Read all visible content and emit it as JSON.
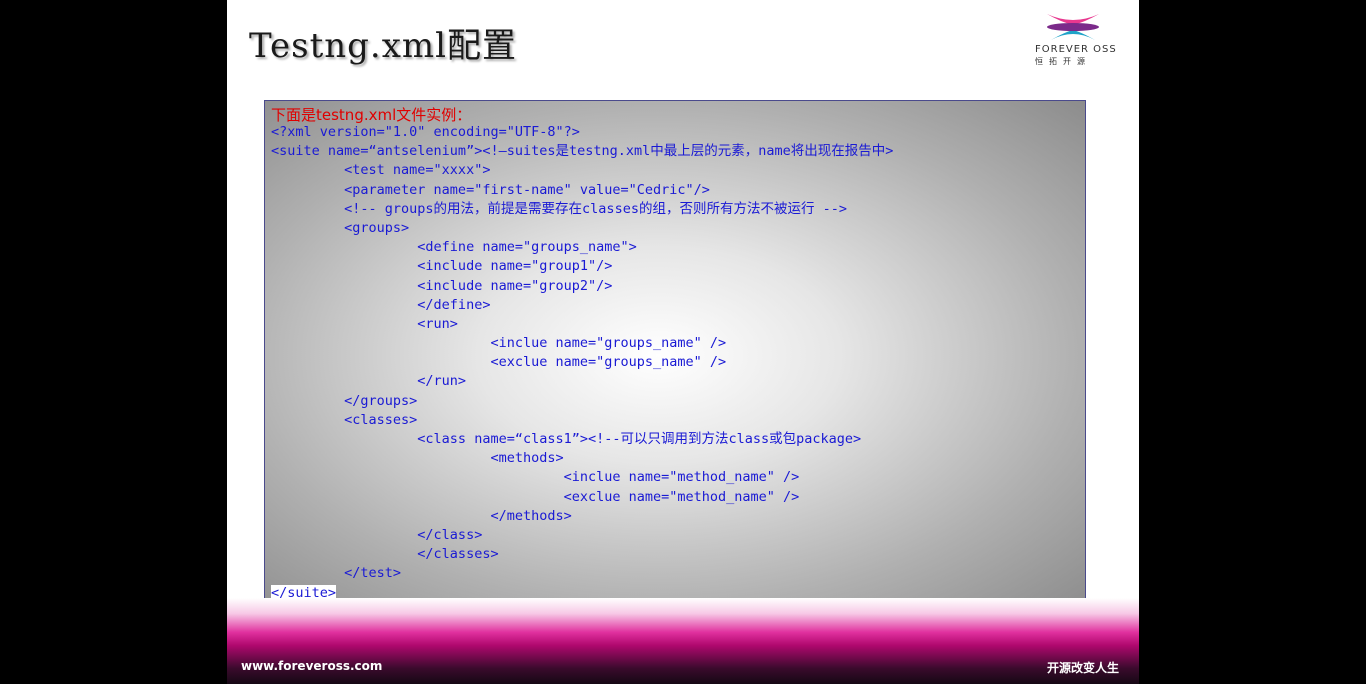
{
  "slide": {
    "title": "Testng.xml配置"
  },
  "logo": {
    "brand_en": "FOREVER OSS",
    "brand_cn": "恒拓开源"
  },
  "code_block": {
    "header": "下面是testng.xml文件实例：",
    "lines": [
      "<?xml version=\"1.0\" encoding=\"UTF-8\"?>",
      "<suite name=“antselenium”><!—suites是testng.xml中最上层的元素，name将出现在报告中>",
      "         <test name=\"xxxx\">",
      "         <parameter name=\"first-name\" value=\"Cedric\"/>",
      "         <!-- groups的用法，前提是需要存在classes的组，否则所有方法不被运行 -->",
      "         <groups>",
      "                  <define name=\"groups_name\">",
      "                  <include name=\"group1\"/>",
      "                  <include name=\"group2\"/>",
      "                  </define>",
      "                  <run>",
      "                           <inclue name=\"groups_name\" />",
      "                           <exclue name=\"groups_name\" />",
      "                  </run>",
      "         </groups>",
      "         <classes>",
      "                  <class name=“class1”><!--可以只调用到方法class或包package>",
      "                           <methods>",
      "                                    <inclue name=\"method_name\" />",
      "                                    <exclue name=\"method_name\" />",
      "                           </methods>",
      "                  </class>",
      "                  </classes>",
      "         </test>",
      "</suite>"
    ]
  },
  "footer": {
    "url": "www.foreveross.com",
    "slogan": "开源改变人生"
  }
}
